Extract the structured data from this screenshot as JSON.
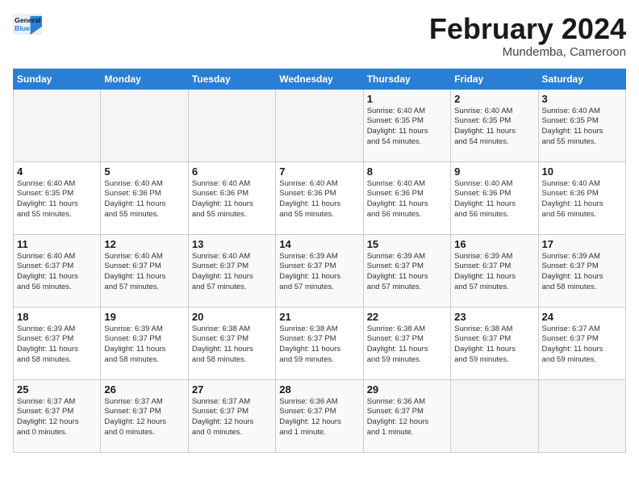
{
  "header": {
    "logo_line1": "General",
    "logo_line2": "Blue",
    "month_title": "February 2024",
    "location": "Mundemba, Cameroon"
  },
  "weekdays": [
    "Sunday",
    "Monday",
    "Tuesday",
    "Wednesday",
    "Thursday",
    "Friday",
    "Saturday"
  ],
  "weeks": [
    [
      {
        "day": "",
        "info": ""
      },
      {
        "day": "",
        "info": ""
      },
      {
        "day": "",
        "info": ""
      },
      {
        "day": "",
        "info": ""
      },
      {
        "day": "1",
        "info": "Sunrise: 6:40 AM\nSunset: 6:35 PM\nDaylight: 11 hours\nand 54 minutes."
      },
      {
        "day": "2",
        "info": "Sunrise: 6:40 AM\nSunset: 6:35 PM\nDaylight: 11 hours\nand 54 minutes."
      },
      {
        "day": "3",
        "info": "Sunrise: 6:40 AM\nSunset: 6:35 PM\nDaylight: 11 hours\nand 55 minutes."
      }
    ],
    [
      {
        "day": "4",
        "info": "Sunrise: 6:40 AM\nSunset: 6:35 PM\nDaylight: 11 hours\nand 55 minutes."
      },
      {
        "day": "5",
        "info": "Sunrise: 6:40 AM\nSunset: 6:36 PM\nDaylight: 11 hours\nand 55 minutes."
      },
      {
        "day": "6",
        "info": "Sunrise: 6:40 AM\nSunset: 6:36 PM\nDaylight: 11 hours\nand 55 minutes."
      },
      {
        "day": "7",
        "info": "Sunrise: 6:40 AM\nSunset: 6:36 PM\nDaylight: 11 hours\nand 55 minutes."
      },
      {
        "day": "8",
        "info": "Sunrise: 6:40 AM\nSunset: 6:36 PM\nDaylight: 11 hours\nand 56 minutes."
      },
      {
        "day": "9",
        "info": "Sunrise: 6:40 AM\nSunset: 6:36 PM\nDaylight: 11 hours\nand 56 minutes."
      },
      {
        "day": "10",
        "info": "Sunrise: 6:40 AM\nSunset: 6:36 PM\nDaylight: 11 hours\nand 56 minutes."
      }
    ],
    [
      {
        "day": "11",
        "info": "Sunrise: 6:40 AM\nSunset: 6:37 PM\nDaylight: 11 hours\nand 56 minutes."
      },
      {
        "day": "12",
        "info": "Sunrise: 6:40 AM\nSunset: 6:37 PM\nDaylight: 11 hours\nand 57 minutes."
      },
      {
        "day": "13",
        "info": "Sunrise: 6:40 AM\nSunset: 6:37 PM\nDaylight: 11 hours\nand 57 minutes."
      },
      {
        "day": "14",
        "info": "Sunrise: 6:39 AM\nSunset: 6:37 PM\nDaylight: 11 hours\nand 57 minutes."
      },
      {
        "day": "15",
        "info": "Sunrise: 6:39 AM\nSunset: 6:37 PM\nDaylight: 11 hours\nand 57 minutes."
      },
      {
        "day": "16",
        "info": "Sunrise: 6:39 AM\nSunset: 6:37 PM\nDaylight: 11 hours\nand 57 minutes."
      },
      {
        "day": "17",
        "info": "Sunrise: 6:39 AM\nSunset: 6:37 PM\nDaylight: 11 hours\nand 58 minutes."
      }
    ],
    [
      {
        "day": "18",
        "info": "Sunrise: 6:39 AM\nSunset: 6:37 PM\nDaylight: 11 hours\nand 58 minutes."
      },
      {
        "day": "19",
        "info": "Sunrise: 6:39 AM\nSunset: 6:37 PM\nDaylight: 11 hours\nand 58 minutes."
      },
      {
        "day": "20",
        "info": "Sunrise: 6:38 AM\nSunset: 6:37 PM\nDaylight: 11 hours\nand 58 minutes."
      },
      {
        "day": "21",
        "info": "Sunrise: 6:38 AM\nSunset: 6:37 PM\nDaylight: 11 hours\nand 59 minutes."
      },
      {
        "day": "22",
        "info": "Sunrise: 6:38 AM\nSunset: 6:37 PM\nDaylight: 11 hours\nand 59 minutes."
      },
      {
        "day": "23",
        "info": "Sunrise: 6:38 AM\nSunset: 6:37 PM\nDaylight: 11 hours\nand 59 minutes."
      },
      {
        "day": "24",
        "info": "Sunrise: 6:37 AM\nSunset: 6:37 PM\nDaylight: 11 hours\nand 59 minutes."
      }
    ],
    [
      {
        "day": "25",
        "info": "Sunrise: 6:37 AM\nSunset: 6:37 PM\nDaylight: 12 hours\nand 0 minutes."
      },
      {
        "day": "26",
        "info": "Sunrise: 6:37 AM\nSunset: 6:37 PM\nDaylight: 12 hours\nand 0 minutes."
      },
      {
        "day": "27",
        "info": "Sunrise: 6:37 AM\nSunset: 6:37 PM\nDaylight: 12 hours\nand 0 minutes."
      },
      {
        "day": "28",
        "info": "Sunrise: 6:36 AM\nSunset: 6:37 PM\nDaylight: 12 hours\nand 1 minute."
      },
      {
        "day": "29",
        "info": "Sunrise: 6:36 AM\nSunset: 6:37 PM\nDaylight: 12 hours\nand 1 minute."
      },
      {
        "day": "",
        "info": ""
      },
      {
        "day": "",
        "info": ""
      }
    ]
  ]
}
